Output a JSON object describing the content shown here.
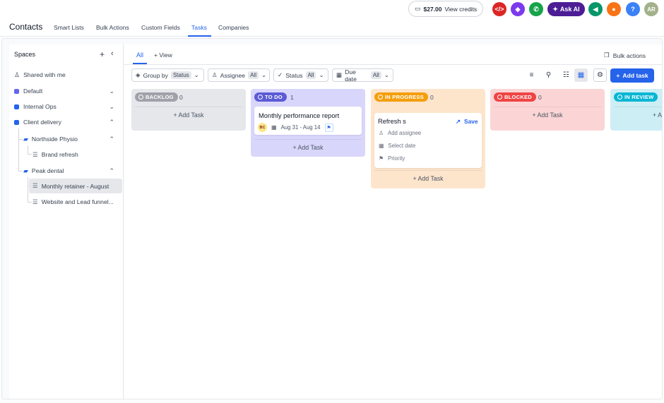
{
  "topbar": {
    "credits_amount": "$27.00",
    "credits_label": "View credits",
    "ask_ai": "Ask AI",
    "help": "?",
    "avatar": "AR",
    "icon_colors": {
      "code": "#dc2626",
      "shield": "#7c3aed",
      "phone": "#16a34a",
      "megaphone": "#059669",
      "bell": "#f97316",
      "help": "#3b82f6",
      "avatar": "#a3b18a"
    }
  },
  "nav": {
    "title": "Contacts",
    "tabs": [
      "Smart Lists",
      "Bulk Actions",
      "Custom Fields",
      "Tasks",
      "Companies"
    ],
    "active_tab": "Tasks"
  },
  "sidebar": {
    "heading": "Spaces",
    "shared": "Shared with me",
    "spaces": [
      {
        "label": "Default",
        "color": "#6366f1"
      },
      {
        "label": "Internal Ops",
        "color": "#2563eb"
      },
      {
        "label": "Client delivery",
        "color": "#2563eb"
      }
    ],
    "folders": [
      "Northside Physio",
      "Peak dental"
    ],
    "lists": [
      "Brand refresh",
      "Monthly retainer - August",
      "Website and Lead funnel..."
    ]
  },
  "toolbar": {
    "view_all": "All",
    "add_view": "+ View",
    "bulk_actions": "Bulk actions",
    "filters": [
      {
        "label": "Group by",
        "value": "Status"
      },
      {
        "label": "Assignee",
        "value": "All"
      },
      {
        "label": "Status",
        "value": "All"
      },
      {
        "label": "Due date",
        "value": "All"
      }
    ],
    "add_task": "Add task"
  },
  "board": {
    "add_task_label": "+ Add Task",
    "columns": [
      {
        "name": "BACKLOG",
        "count": "0",
        "badge": "#a1a1aa",
        "bg": "#e5e7eb"
      },
      {
        "name": "TO DO",
        "count": "1",
        "badge": "#5b5bd6",
        "bg": "#d9d6fb"
      },
      {
        "name": "IN PROGRESS",
        "count": "0",
        "badge": "#f59e0b",
        "bg": "#fde5cc"
      },
      {
        "name": "BLOCKED",
        "count": "0",
        "badge": "#ef4444",
        "bg": "#fbd5d5"
      },
      {
        "name": "IN REVIEW",
        "count": "",
        "badge": "#06b6d4",
        "bg": "#cdeef5"
      }
    ],
    "todo_card": {
      "title": "Monthly performance report",
      "assignee_initials": "BC",
      "date": "Aug 31 - Aug 14"
    },
    "new_task": {
      "value": "Refresh s",
      "save": "Save",
      "assignee": "Add assignee",
      "date": "Select date",
      "priority": "Priority"
    }
  }
}
